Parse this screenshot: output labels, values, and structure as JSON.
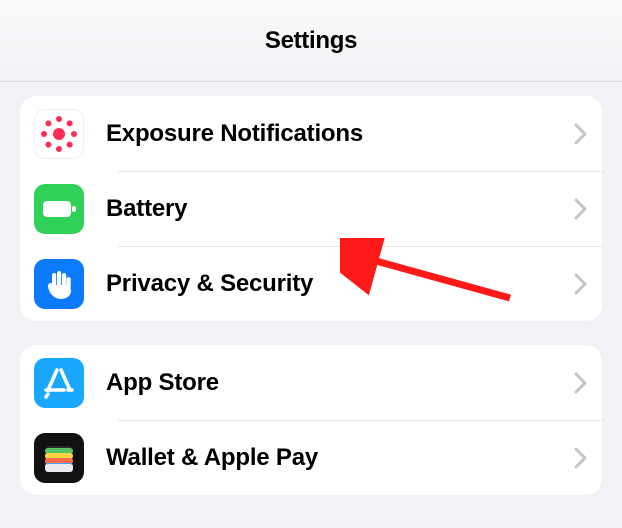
{
  "header": {
    "title": "Settings"
  },
  "group1": {
    "items": [
      {
        "label": "Exposure Notifications"
      },
      {
        "label": "Battery"
      },
      {
        "label": "Privacy & Security"
      }
    ]
  },
  "group2": {
    "items": [
      {
        "label": "App Store"
      },
      {
        "label": "Wallet & Apple Pay"
      }
    ]
  }
}
